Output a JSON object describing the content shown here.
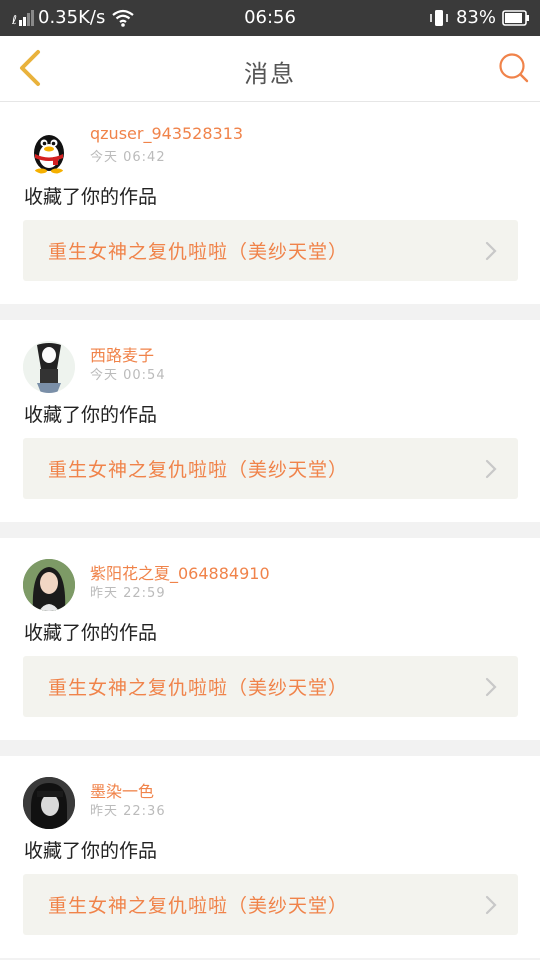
{
  "status_bar": {
    "network_speed": "0.35K/s",
    "time": "06:56",
    "battery": "83%"
  },
  "header": {
    "title": "消息"
  },
  "messages": [
    {
      "username": "qzuser_943528313",
      "time": "今天 06:42",
      "action": "收藏了你的作品",
      "work_title": "重生女神之复仇啦啦（美纱天堂）",
      "avatar": "qq-penguin-avatar"
    },
    {
      "username": "西路麦子",
      "time": "今天 00:54",
      "action": "收藏了你的作品",
      "work_title": "重生女神之复仇啦啦（美纱天堂）",
      "avatar": "girl-sketch-avatar"
    },
    {
      "username": "紫阳花之夏_064884910",
      "time": "昨天 22:59",
      "action": "收藏了你的作品",
      "work_title": "重生女神之复仇啦啦（美纱天堂）",
      "avatar": "girl-photo-avatar"
    },
    {
      "username": "墨染一色",
      "time": "昨天 22:36",
      "action": "收藏了你的作品",
      "work_title": "重生女神之复仇啦啦（美纱天堂）",
      "avatar": "dark-girl-avatar"
    }
  ],
  "colors": {
    "accent": "#f0834a",
    "back_icon": "#e9b23c",
    "status_bar": "#3a3a3a",
    "link_bg": "#f3f3ee"
  }
}
